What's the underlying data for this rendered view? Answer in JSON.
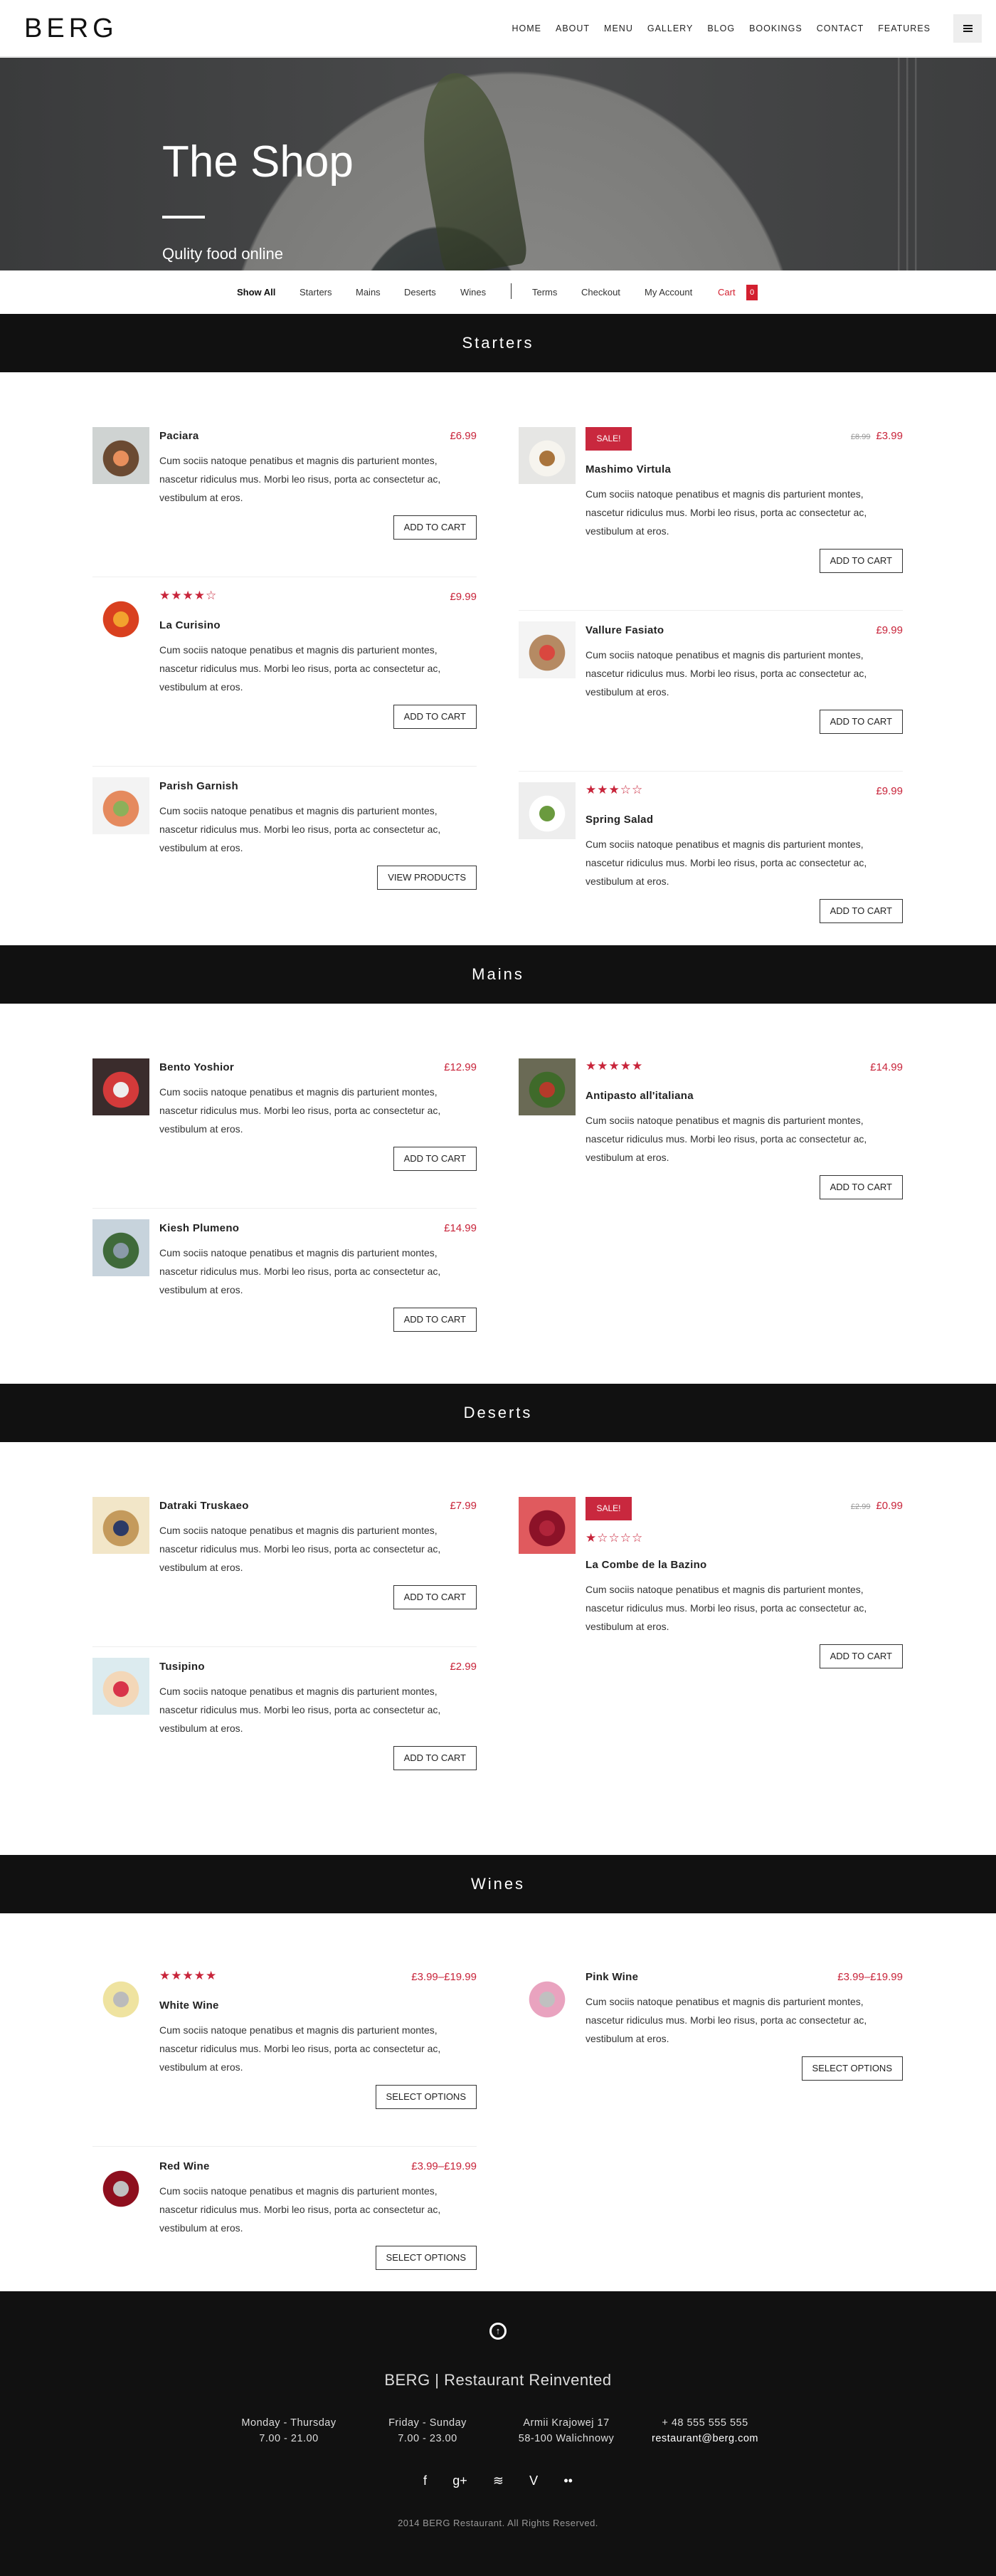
{
  "header": {
    "logo": "BERG",
    "nav": [
      "HOME",
      "ABOUT",
      "MENU",
      "GALLERY",
      "BLOG",
      "BOOKINGS",
      "CONTACT",
      "FEATURES"
    ],
    "menu_icon": "hamburger-icon"
  },
  "hero": {
    "title": "The Shop",
    "subtitle": "Qulity food online"
  },
  "filter": {
    "items": [
      "Show All",
      "Starters",
      "Mains",
      "Deserts",
      "Wines"
    ],
    "links": [
      "Terms",
      "Checkout",
      "My Account"
    ],
    "cart_label": "Cart",
    "cart_count": "0"
  },
  "colors": {
    "accent": "#c8243a",
    "band": "#111111",
    "footer": "#111111"
  },
  "sections": [
    {
      "title": "Starters",
      "columns": [
        [
          {
            "name": "Paciara",
            "price": "£6.99",
            "description": "Cum sociis natoque penatibus et magnis dis parturient montes, nascetur ridiculus mus. Morbi leo risus, porta ac consectetur ac, vestibulum at eros.",
            "button": "ADD TO CART",
            "thumb": [
              "#cfd3d2",
              "#6b4a32",
              "#e88f5c"
            ]
          },
          {
            "name": "La Curisino",
            "price": "£9.99",
            "rating": 4,
            "description": "Cum sociis natoque penatibus et magnis dis parturient montes, nascetur ridiculus mus. Morbi leo risus, porta ac consectetur ac, vestibulum at eros.",
            "button": "ADD TO CART",
            "thumb": [
              "#ffffff",
              "#d9401f",
              "#f2a22e"
            ]
          },
          {
            "name": "Parish Garnish",
            "description": "Cum sociis natoque penatibus et magnis dis parturient montes, nascetur ridiculus mus. Morbi leo risus, porta ac consectetur ac, vestibulum at eros.",
            "button": "VIEW PRODUCTS",
            "thumb": [
              "#f3f3f3",
              "#e58a5e",
              "#8cb05a"
            ]
          }
        ],
        [
          {
            "name": "Mashimo Virtula",
            "price": "£3.99",
            "old_price": "£8.99",
            "sale": "SALE!",
            "description": "Cum sociis natoque penatibus et magnis dis parturient montes, nascetur ridiculus mus. Morbi leo risus, porta ac consectetur ac, vestibulum at eros.",
            "button": "ADD TO CART",
            "thumb": [
              "#e6e6e4",
              "#f6f4ee",
              "#a9743c"
            ]
          },
          {
            "name": "Vallure Fasiato",
            "price": "£9.99",
            "description": "Cum sociis natoque penatibus et magnis dis parturient montes, nascetur ridiculus mus. Morbi leo risus, porta ac consectetur ac, vestibulum at eros.",
            "button": "ADD TO CART",
            "thumb": [
              "#f4f4f4",
              "#b58a63",
              "#d9473f"
            ]
          },
          {
            "name": "Spring Salad",
            "price": "£9.99",
            "rating": 3,
            "description": "Cum sociis natoque penatibus et magnis dis parturient montes, nascetur ridiculus mus. Morbi leo risus, porta ac consectetur ac, vestibulum at eros.",
            "button": "ADD TO CART",
            "thumb": [
              "#eeeeee",
              "#ffffff",
              "#6a9a3e"
            ]
          }
        ]
      ]
    },
    {
      "title": "Mains",
      "columns": [
        [
          {
            "name": "Bento Yoshior",
            "price": "£12.99",
            "description": "Cum sociis natoque penatibus et magnis dis parturient montes, nascetur ridiculus mus. Morbi leo risus, porta ac consectetur ac, vestibulum at eros.",
            "button": "ADD TO CART",
            "thumb": [
              "#3a2c2c",
              "#d33a3a",
              "#eeeeee"
            ]
          },
          {
            "name": "Kiesh Plumeno",
            "price": "£14.99",
            "description": "Cum sociis natoque penatibus et magnis dis parturient montes, nascetur ridiculus mus. Morbi leo risus, porta ac consectetur ac, vestibulum at eros.",
            "button": "ADD TO CART",
            "thumb": [
              "#c7d3dc",
              "#3f6a3a",
              "#8a9aa8"
            ]
          }
        ],
        [
          {
            "name": "Antipasto all'italiana",
            "price": "£14.99",
            "rating": 5,
            "description": "Cum sociis natoque penatibus et magnis dis parturient montes, nascetur ridiculus mus. Morbi leo risus, porta ac consectetur ac, vestibulum at eros.",
            "button": "ADD TO CART",
            "thumb": [
              "#6a6a55",
              "#3f6a2a",
              "#b53a2a"
            ]
          }
        ]
      ]
    },
    {
      "title": "Deserts",
      "columns": [
        [
          {
            "name": "Datraki Truskaeo",
            "price": "£7.99",
            "description": "Cum sociis natoque penatibus et magnis dis parturient montes, nascetur ridiculus mus. Morbi leo risus, porta ac consectetur ac, vestibulum at eros.",
            "button": "ADD TO CART",
            "thumb": [
              "#f2e6c8",
              "#c49a5c",
              "#2c3a66"
            ]
          },
          {
            "name": "Tusipino",
            "price": "£2.99",
            "description": "Cum sociis natoque penatibus et magnis dis parturient montes, nascetur ridiculus mus. Morbi leo risus, porta ac consectetur ac, vestibulum at eros.",
            "button": "ADD TO CART",
            "thumb": [
              "#dcebef",
              "#f3d7b8",
              "#d8344a"
            ]
          }
        ],
        [
          {
            "name": "La Combe de la Bazino",
            "price": "£0.99",
            "old_price": "£2.99",
            "sale": "SALE!",
            "rating": 1,
            "description": "Cum sociis natoque penatibus et magnis dis parturient montes, nascetur ridiculus mus. Morbi leo risus, porta ac consectetur ac, vestibulum at eros.",
            "button": "ADD TO CART",
            "thumb": [
              "#e05a5e",
              "#8c1228",
              "#b0243a"
            ]
          }
        ]
      ]
    },
    {
      "title": "Wines",
      "columns": [
        [
          {
            "name": "White Wine",
            "price": "£3.99–£19.99",
            "rating": 5,
            "description": "Cum sociis natoque penatibus et magnis dis parturient montes, nascetur ridiculus mus. Morbi leo risus, porta ac consectetur ac, vestibulum at eros.",
            "button": "SELECT OPTIONS",
            "thumb": [
              "#ffffff",
              "#efe3a0",
              "#bbbbbb"
            ]
          },
          {
            "name": "Red Wine",
            "price": "£3.99–£19.99",
            "description": "Cum sociis natoque penatibus et magnis dis parturient montes, nascetur ridiculus mus. Morbi leo risus, porta ac consectetur ac, vestibulum at eros.",
            "button": "SELECT OPTIONS",
            "thumb": [
              "#ffffff",
              "#8e0f1e",
              "#c0c0c0"
            ]
          }
        ],
        [
          {
            "name": "Pink Wine",
            "price": "£3.99–£19.99",
            "description": "Cum sociis natoque penatibus et magnis dis parturient montes, nascetur ridiculus mus. Morbi leo risus, porta ac consectetur ac, vestibulum at eros.",
            "button": "SELECT OPTIONS",
            "thumb": [
              "#ffffff",
              "#e9a3bf",
              "#c0c0c0"
            ]
          }
        ]
      ]
    }
  ],
  "footer": {
    "title": "BERG | Restaurant Reinvented",
    "columns": [
      {
        "line1": "Monday - Thursday",
        "line2": "7.00 - 21.00"
      },
      {
        "line1": "Friday - Sunday",
        "line2": "7.00 - 23.00"
      },
      {
        "line1": "Armii Krajowej 17",
        "line2": "58-100 Walichnowy"
      },
      {
        "line1": "+ 48 555 555 555",
        "line2": "restaurant@berg.com"
      }
    ],
    "social": [
      {
        "icon": "facebook-icon",
        "glyph": "f"
      },
      {
        "icon": "google-plus-icon",
        "glyph": "g+"
      },
      {
        "icon": "spotify-icon",
        "glyph": "≋"
      },
      {
        "icon": "vine-icon",
        "glyph": "V"
      },
      {
        "icon": "flickr-icon",
        "glyph": "••"
      }
    ],
    "copyright": "2014 BERG Restaurant. All Rights Reserved."
  }
}
